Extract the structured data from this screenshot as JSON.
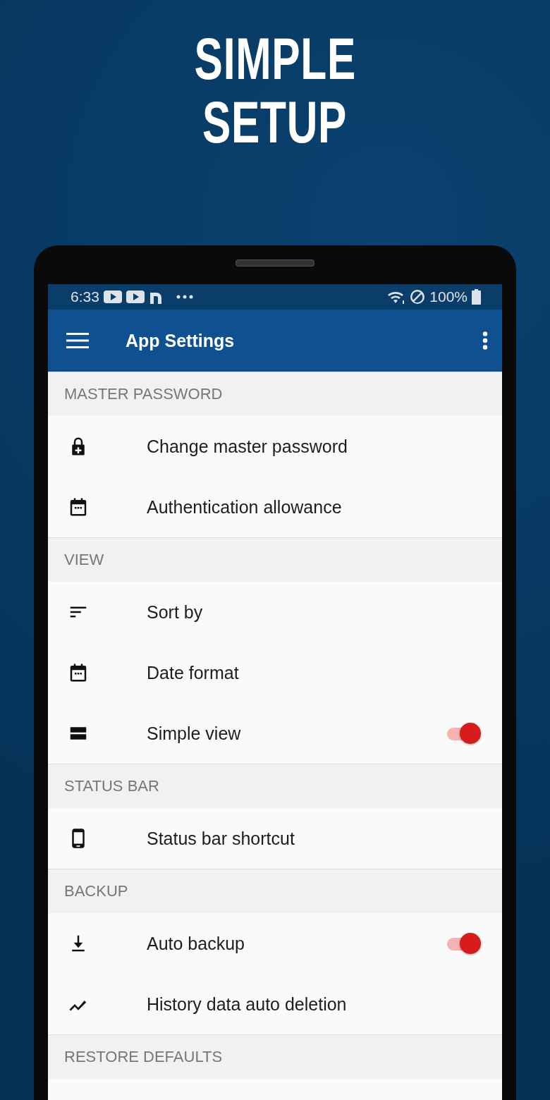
{
  "headline": [
    "SIMPLE",
    "SETUP"
  ],
  "status_bar": {
    "time": "6:33",
    "battery": "100%"
  },
  "app_bar": {
    "title": "App Settings"
  },
  "sections": [
    {
      "title": "MASTER PASSWORD",
      "items": [
        {
          "kind": "plain",
          "label": "Change master password"
        },
        {
          "kind": "plain",
          "label": "Authentication allowance"
        }
      ]
    },
    {
      "title": "VIEW",
      "items": [
        {
          "kind": "plain",
          "label": "Sort by"
        },
        {
          "kind": "plain",
          "label": "Date format"
        },
        {
          "kind": "toggle",
          "label": "Simple view",
          "on": true
        }
      ]
    },
    {
      "title": "STATUS BAR",
      "items": [
        {
          "kind": "plain",
          "label": "Status bar shortcut"
        }
      ]
    },
    {
      "title": "BACKUP",
      "items": [
        {
          "kind": "toggle",
          "label": "Auto backup",
          "on": true
        },
        {
          "kind": "plain",
          "label": "History data auto deletion"
        }
      ]
    },
    {
      "title": "RESTORE DEFAULTS"
    }
  ]
}
